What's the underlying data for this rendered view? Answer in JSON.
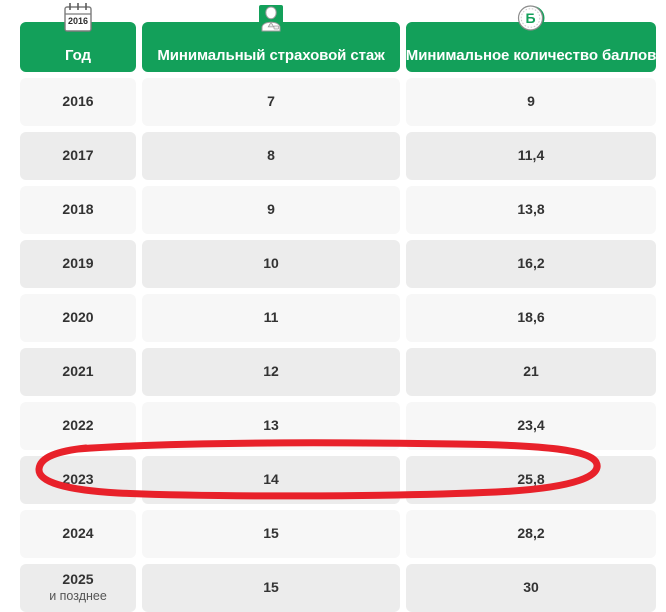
{
  "colors": {
    "header_green": "#13a05a",
    "row_light": "#f7f7f7",
    "row_dark": "#ececec",
    "text_dark": "#333333",
    "highlight_red": "#e8212a",
    "white": "#ffffff"
  },
  "table": {
    "columns": [
      {
        "key": "year",
        "label": "Год",
        "icon": "calendar-icon",
        "icon_text": "2016"
      },
      {
        "key": "stazh",
        "label": "Минимальный страховой стаж",
        "icon": "worker-icon",
        "icon_text": ""
      },
      {
        "key": "bally",
        "label": "Минимальное количество баллов",
        "icon": "coin-ball-icon",
        "icon_text": "Б"
      }
    ],
    "rows": [
      {
        "year": "2016",
        "year_note": "",
        "stazh": "7",
        "bally": "9",
        "highlighted": false
      },
      {
        "year": "2017",
        "year_note": "",
        "stazh": "8",
        "bally": "11,4",
        "highlighted": false
      },
      {
        "year": "2018",
        "year_note": "",
        "stazh": "9",
        "bally": "13,8",
        "highlighted": false
      },
      {
        "year": "2019",
        "year_note": "",
        "stazh": "10",
        "bally": "16,2",
        "highlighted": false
      },
      {
        "year": "2020",
        "year_note": "",
        "stazh": "11",
        "bally": "18,6",
        "highlighted": false
      },
      {
        "year": "2021",
        "year_note": "",
        "stazh": "12",
        "bally": "21",
        "highlighted": false
      },
      {
        "year": "2022",
        "year_note": "",
        "stazh": "13",
        "bally": "23,4",
        "highlighted": false
      },
      {
        "year": "2023",
        "year_note": "",
        "stazh": "14",
        "bally": "25,8",
        "highlighted": true
      },
      {
        "year": "2024",
        "year_note": "",
        "stazh": "15",
        "bally": "28,2",
        "highlighted": false
      },
      {
        "year": "2025",
        "year_note": "и позднее",
        "stazh": "15",
        "bally": "30",
        "highlighted": false
      }
    ]
  },
  "annotation": {
    "type": "hand-drawn-ellipse",
    "target_row_year": "2023",
    "color": "#e8212a"
  }
}
